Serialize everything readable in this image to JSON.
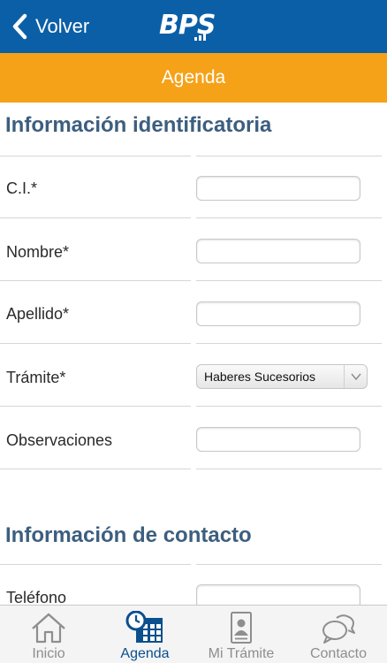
{
  "header": {
    "back_label": "Volver",
    "logo_text": "BPS",
    "background_color": "#0b5fa7"
  },
  "subheader": {
    "title": "Agenda",
    "background_color": "#f5a218"
  },
  "section_identification": {
    "title": "Información identificatoria",
    "fields": [
      {
        "label": "C.I.*",
        "value": ""
      },
      {
        "label": "Nombre*",
        "value": ""
      },
      {
        "label": "Apellido*",
        "value": ""
      },
      {
        "label": "Trámite*",
        "selected": "Haberes Sucesorios"
      },
      {
        "label": "Observaciones",
        "value": ""
      }
    ]
  },
  "section_contact": {
    "title": "Información de contacto",
    "fields": [
      {
        "label": "Teléfono",
        "value": ""
      }
    ]
  },
  "tabbar": {
    "active_color": "#0b4f8d",
    "tabs": [
      {
        "label": "Inicio",
        "icon": "home-icon"
      },
      {
        "label": "Agenda",
        "icon": "calendar-clock-icon",
        "active": true
      },
      {
        "label": "Mi Trámite",
        "icon": "document-person-icon"
      },
      {
        "label": "Contacto",
        "icon": "chat-bubbles-icon"
      }
    ]
  }
}
